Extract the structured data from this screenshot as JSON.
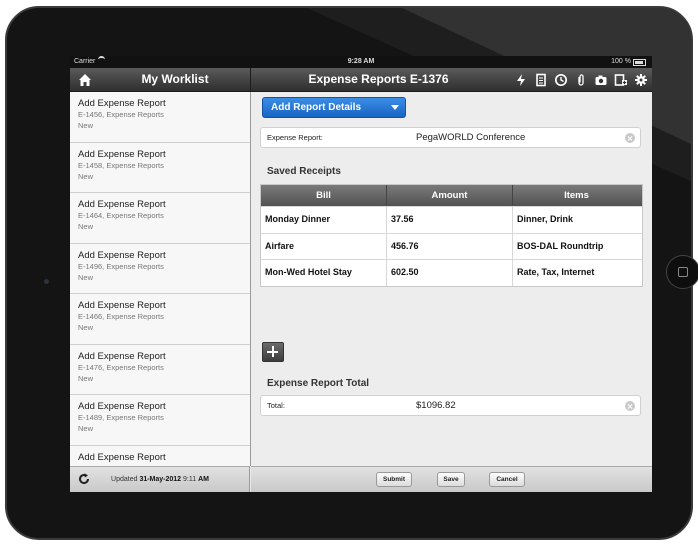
{
  "status_bar": {
    "carrier": "Carrier",
    "time": "9:28 AM",
    "battery": "100 %"
  },
  "sidebar": {
    "title": "My Worklist",
    "items": [
      {
        "title": "Add Expense Report",
        "subtitle": "E-1456, Expense Reports",
        "status": "New"
      },
      {
        "title": "Add Expense Report",
        "subtitle": "E-1458, Expense Reports",
        "status": "New"
      },
      {
        "title": "Add Expense Report",
        "subtitle": "E-1464, Expense Reports",
        "status": "New"
      },
      {
        "title": "Add Expense Report",
        "subtitle": "E-1496, Expense Reports",
        "status": "New"
      },
      {
        "title": "Add Expense Report",
        "subtitle": "E-1466, Expense Reports",
        "status": "New"
      },
      {
        "title": "Add Expense Report",
        "subtitle": "E-1476, Expense Reports",
        "status": "New"
      },
      {
        "title": "Add Expense Report",
        "subtitle": "E-1489, Expense Reports",
        "status": "New"
      },
      {
        "title": "Add Expense Report",
        "subtitle": "",
        "status": ""
      }
    ],
    "footer": {
      "prefix": "Updated",
      "date": "31-May-2012",
      "time": "9:11",
      "ampm": "AM"
    }
  },
  "main": {
    "title": "Expense Reports E-1376",
    "add_details_button": "Add Report Details",
    "expense_report": {
      "label": "Expense Report:",
      "value": "PegaWORLD Conference"
    },
    "saved_receipts_title": "Saved Receipts",
    "receipts_columns": [
      "Bill",
      "Amount",
      "Items"
    ],
    "receipts": [
      {
        "bill": "Monday Dinner",
        "amount": "37.56",
        "items": "Dinner, Drink"
      },
      {
        "bill": "Airfare",
        "amount": "456.76",
        "items": "BOS-DAL Roundtrip"
      },
      {
        "bill": "Mon-Wed Hotel Stay",
        "amount": "602.50",
        "items": "Rate, Tax, Internet"
      }
    ],
    "total_section_title": "Expense Report Total",
    "total": {
      "label": "Total:",
      "value": "$1096.82"
    },
    "buttons": {
      "submit": "Submit",
      "save": "Save",
      "cancel": "Cancel"
    }
  },
  "icons": {
    "nav_left": "home-icon",
    "nav_right": [
      "flash-icon",
      "document-icon",
      "history-icon",
      "attachment-icon",
      "camera-icon",
      "new-item-icon",
      "gear-icon"
    ],
    "footer": "refresh-icon"
  },
  "colors": {
    "primary_button": "#1f6fd1",
    "nav_bar": "#3b3b3b",
    "table_header": "#616161"
  }
}
